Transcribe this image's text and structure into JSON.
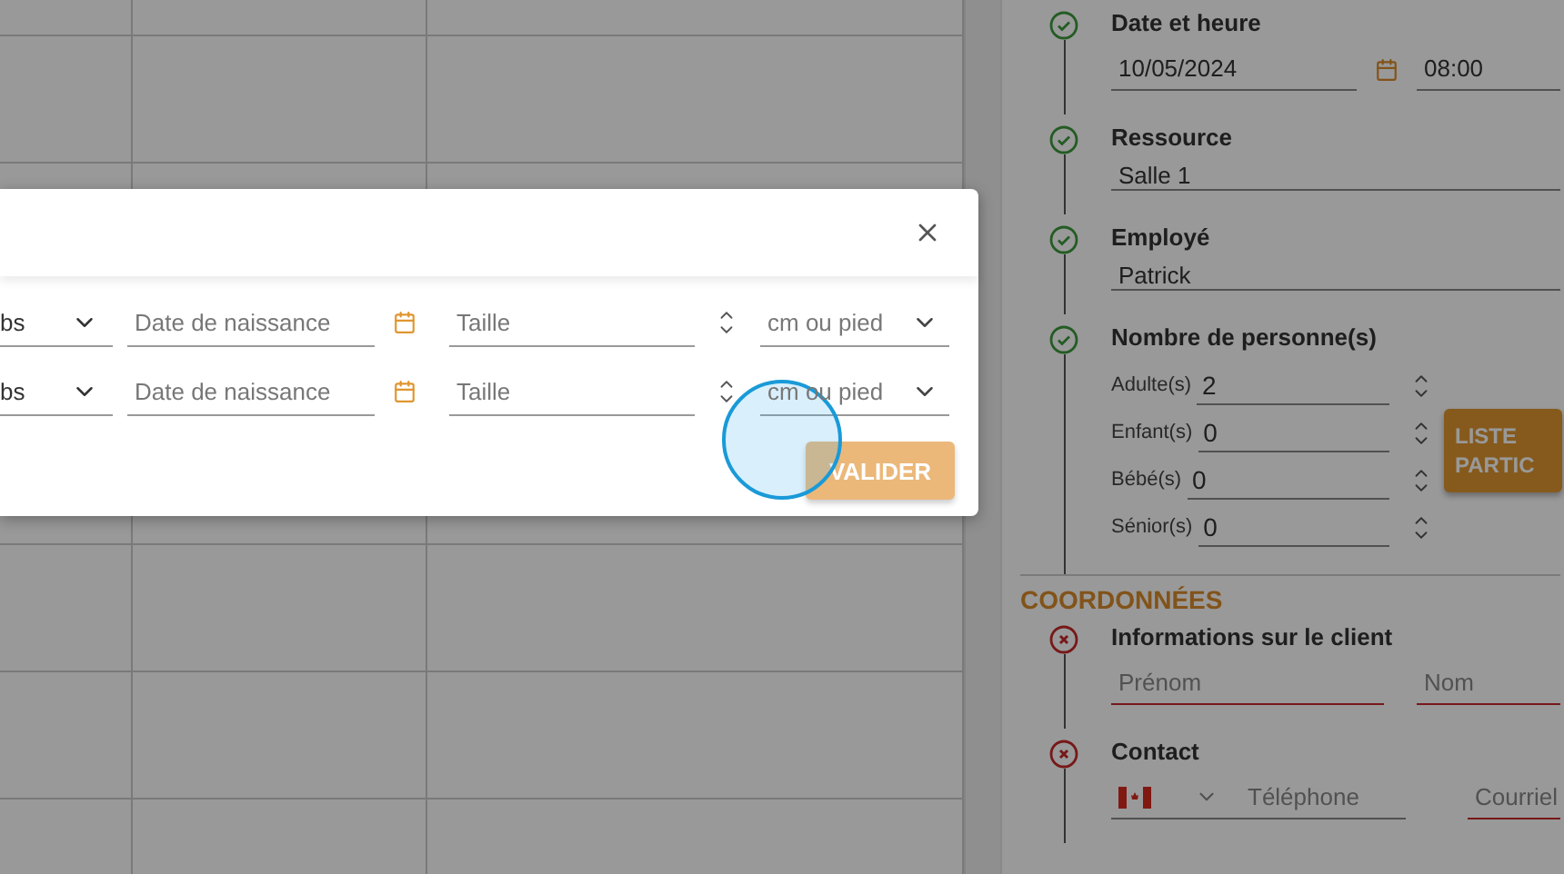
{
  "modal": {
    "rows": [
      {
        "weight_unit": {
          "value": "bs"
        },
        "birthdate": {
          "placeholder": "Date de naissance"
        },
        "height": {
          "placeholder": "Taille"
        },
        "height_unit": {
          "placeholder": "cm ou pied"
        }
      },
      {
        "weight_unit": {
          "value": "bs"
        },
        "birthdate": {
          "placeholder": "Date de naissance"
        },
        "height": {
          "placeholder": "Taille"
        },
        "height_unit": {
          "placeholder": "cm ou pied"
        }
      }
    ],
    "submit": {
      "label": "VALIDER",
      "disabled": true
    }
  },
  "form": {
    "steps": [
      {
        "kind": "datetime",
        "title": "Date et heure",
        "complete": true,
        "date": "10/05/2024",
        "time": "08:00"
      },
      {
        "kind": "select",
        "title": "Ressource",
        "complete": true,
        "value": "Salle 1"
      },
      {
        "kind": "select",
        "title": "Employé",
        "complete": true,
        "value": "Patrick"
      },
      {
        "kind": "counts",
        "title": "Nombre de personne(s)",
        "complete": true,
        "counts": [
          {
            "label": "Adulte(s)",
            "value": "2"
          },
          {
            "label": "Enfant(s)",
            "value": "0"
          },
          {
            "label": "Bébé(s)",
            "value": "0"
          },
          {
            "label": "Sénior(s)",
            "value": "0"
          }
        ],
        "button": "LISTE PARTIC"
      }
    ],
    "section_title": "COORDONNÉES",
    "contact_steps": [
      {
        "kind": "name",
        "title": "Informations sur le client",
        "complete": false,
        "fields": [
          {
            "placeholder": "Prénom",
            "invalid": true
          },
          {
            "placeholder": "Nom",
            "invalid": true
          }
        ]
      },
      {
        "kind": "contact",
        "title": "Contact",
        "complete": false,
        "phone": {
          "placeholder": "Téléphone",
          "invalid": false
        },
        "email": {
          "placeholder": "Courriel",
          "invalid": true
        }
      }
    ]
  }
}
